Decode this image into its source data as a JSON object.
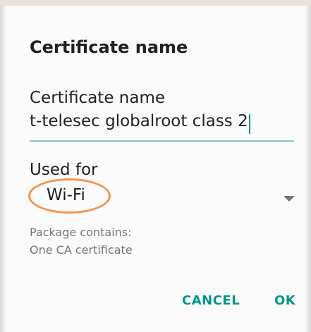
{
  "dialog": {
    "title": "Certificate name",
    "certificate_name": {
      "label": "Certificate name",
      "value": "t-telesec globalroot class 2"
    },
    "used_for": {
      "label": "Used for",
      "selected": "Wi-Fi"
    },
    "package_info": {
      "line1": "Package contains:",
      "line2": "One CA certificate"
    },
    "buttons": {
      "cancel": "CANCEL",
      "ok": "OK"
    }
  },
  "colors": {
    "accent": "#009688",
    "underline": "#80cbc4",
    "highlight": "#f09550",
    "text_primary": "#212121",
    "text_secondary": "#757575",
    "dialog_bg": "#fafafa"
  },
  "icons": {
    "dropdown": "triangle-down-icon"
  }
}
